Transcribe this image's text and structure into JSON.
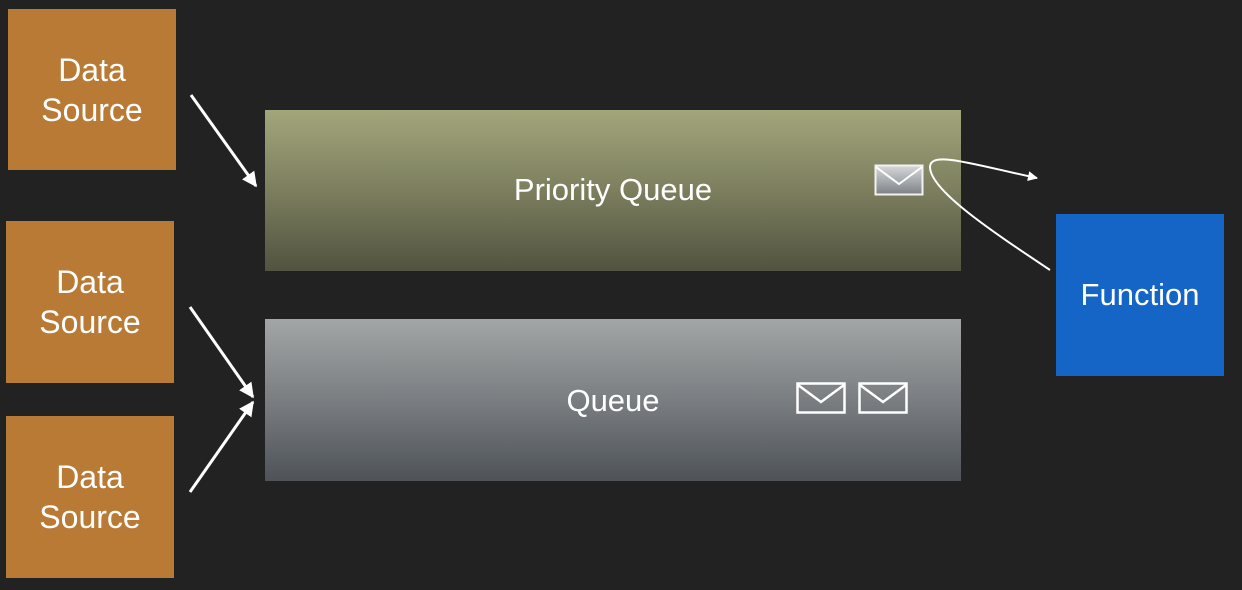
{
  "sources": [
    {
      "label": "Data\nSource"
    },
    {
      "label": "Data\nSource"
    },
    {
      "label": "Data\nSource"
    }
  ],
  "queues": {
    "priority": {
      "label": "Priority Queue",
      "messages": 1
    },
    "normal": {
      "label": "Queue",
      "messages": 2
    }
  },
  "function": {
    "label": "Function"
  },
  "icons": {
    "message": "envelope-icon",
    "arrow": "arrow-icon"
  },
  "colors": {
    "background": "#222222",
    "source": "#b97a35",
    "function": "#1565c6",
    "arrow": "#ffffff"
  }
}
